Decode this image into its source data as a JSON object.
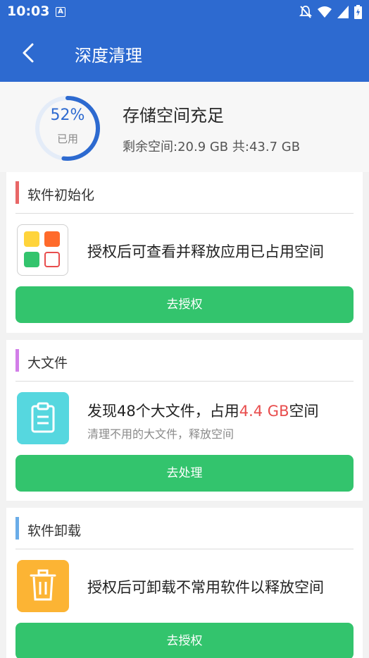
{
  "status_bar": {
    "time": "10:03",
    "notification_icon_letter": "A"
  },
  "app_bar": {
    "title": "深度清理"
  },
  "storage": {
    "used_percent": 52,
    "percent_label": "52%",
    "used_label": "已用",
    "title": "存储空间充足",
    "space_text": "剩余空间:20.9 GB 共:43.7 GB",
    "ring_color": "#2d6ad0"
  },
  "cards": [
    {
      "title": "软件初始化",
      "accent": "#e86767",
      "text": "授权后可查看并释放应用已占用空间",
      "button": "去授权"
    },
    {
      "title": "大文件",
      "accent": "#d27ee8",
      "text_prefix": "发现48个大文件，占用",
      "text_highlight": "4.4 GB",
      "text_suffix": "空间",
      "sub": "清理不用的大文件，释放空间",
      "button": "去处理"
    },
    {
      "title": "软件卸载",
      "accent": "#6aace8",
      "text": "授权后可卸载不常用软件以释放空间",
      "button": "去授权"
    }
  ],
  "colors": {
    "primary": "#2d6ad0",
    "button_green": "#33c46d",
    "highlight": "#e84d4d"
  },
  "icons": [
    "back-arrow-icon",
    "clipboard-icon",
    "trash-icon",
    "app-grid-icon"
  ]
}
